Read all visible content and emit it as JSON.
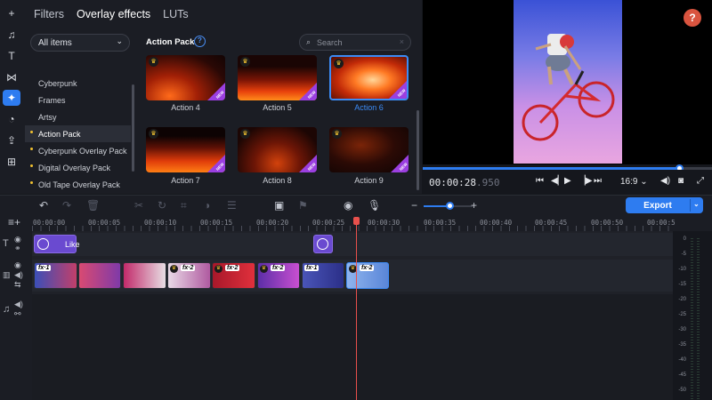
{
  "toolbar": {
    "items": [
      {
        "name": "add-icon",
        "glyph": "+"
      },
      {
        "name": "music-icon",
        "glyph": "♫"
      },
      {
        "name": "text-icon",
        "glyph": "T"
      },
      {
        "name": "transitions-icon",
        "glyph": "⋈"
      },
      {
        "name": "effects-icon",
        "glyph": "✦"
      },
      {
        "name": "stickers-icon",
        "glyph": "◔"
      },
      {
        "name": "import-icon",
        "glyph": "⇪"
      },
      {
        "name": "more-tools-icon",
        "glyph": "⊞"
      }
    ]
  },
  "tabs": {
    "filters": "Filters",
    "overlay": "Overlay effects",
    "luts": "LUTs"
  },
  "categories": {
    "select_value": "All items",
    "items": [
      "Cyberpunk",
      "Frames",
      "Artsy",
      "Action Pack",
      "Cyberpunk Overlay Pack",
      "Digital Overlay Pack",
      "Old Tape Overlay Pack"
    ],
    "selected": "Action Pack"
  },
  "grid": {
    "title": "Action Pack",
    "help": "?",
    "search_placeholder": "Search",
    "search_clear": "×",
    "new_badge": "NEW",
    "items": [
      {
        "label": "Action 4",
        "new": true
      },
      {
        "label": "Action 5",
        "new": true
      },
      {
        "label": "Action 6",
        "new": true,
        "selected": true
      },
      {
        "label": "Action 7",
        "new": true
      },
      {
        "label": "Action 8",
        "new": true
      },
      {
        "label": "Action 9",
        "new": true
      }
    ]
  },
  "preview": {
    "help": "?",
    "time_main": "00:00:28",
    "time_ms": ".950",
    "ratio": "16:9",
    "progress": 0.89
  },
  "timeline": {
    "export_label": "Export",
    "zoom_level": 0.55,
    "ruler": [
      "00:00:00",
      "00:00:05",
      "00:00:10",
      "00:00:15",
      "00:00:20",
      "00:00:25",
      "00:00:30",
      "00:00:35",
      "00:00:40",
      "00:00:45",
      "00:00:50",
      "00:00:5"
    ],
    "title_clip_text": "Like",
    "fx1": "fx·1",
    "fx2": "fx·2",
    "meter_labels": [
      "0",
      "-5",
      "-10",
      "-15",
      "-20",
      "-25",
      "-30",
      "-35",
      "-40",
      "-45",
      "-50"
    ]
  },
  "colors": {
    "accent": "#2e7cf0",
    "playhead": "#e8504c",
    "new_badge": "#9b3fe0",
    "title_clip": "#6a4ad0"
  }
}
